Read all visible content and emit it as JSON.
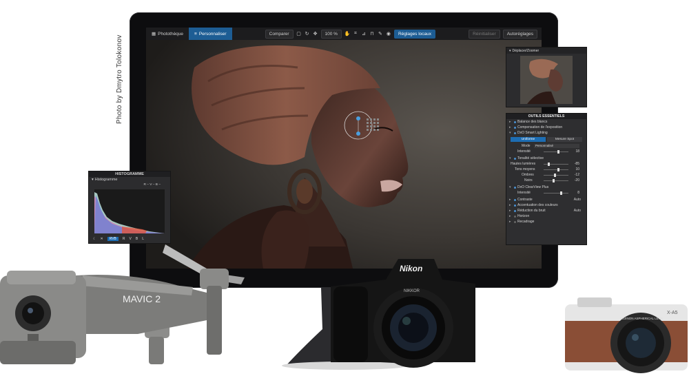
{
  "credit": "Photo by Dmytro Tolokonov",
  "toolbar": {
    "tab_library": "Photothèque",
    "tab_customize": "Personnaliser",
    "compare": "Comparer",
    "zoom": "100 %",
    "local_adjustments": "Réglages locaux",
    "reset": "Réinitialiser",
    "auto": "Autoréglages"
  },
  "navigator": {
    "title": "Déplacer/Zoomer"
  },
  "tools": {
    "title": "OUTILS ESSENTIELS",
    "white_balance": "Balance des blancs",
    "exposure": "Compensation de l'exposition",
    "smart_lighting": "DxO Smart Lighting",
    "tab_uniform": "Uniforme",
    "tab_spot": "Mesure Spot",
    "mode_label": "Mode",
    "mode_value": "Personnalisé",
    "intensity_label": "Intensité",
    "intensity_value": "18",
    "selective_tone": "Tonalité sélective",
    "highlights_label": "Hautes lumières",
    "highlights_value": "-85",
    "midtones_label": "Tons moyens",
    "midtones_value": "10",
    "shadows_label": "Ombres",
    "shadows_value": "-12",
    "blacks_label": "Noirs",
    "blacks_value": "-20",
    "clearview": "DxO ClearView Plus",
    "cv_intensity_label": "Intensité",
    "cv_intensity_value": "8",
    "contrast": "Contraste",
    "contrast_auto": "Auto",
    "color_accent": "Accentuation des couleurs",
    "noise": "Réduction du bruit",
    "noise_auto": "Auto",
    "horizon": "Horizon",
    "crop": "Recadrage"
  },
  "histogram": {
    "title": "HISTOGRAMME",
    "label": "Histogramme",
    "readout": "R – V – B –",
    "rgb": "RVB",
    "r": "R",
    "v": "V",
    "b": "B",
    "l": "L"
  },
  "products": {
    "drone": "MAVIC 2",
    "nikon": "Nikon",
    "nikkor": "NIKKOR",
    "fuji_model": "X-A5",
    "fuji_lens": "FUJINON ASPHERICAL LENS"
  }
}
